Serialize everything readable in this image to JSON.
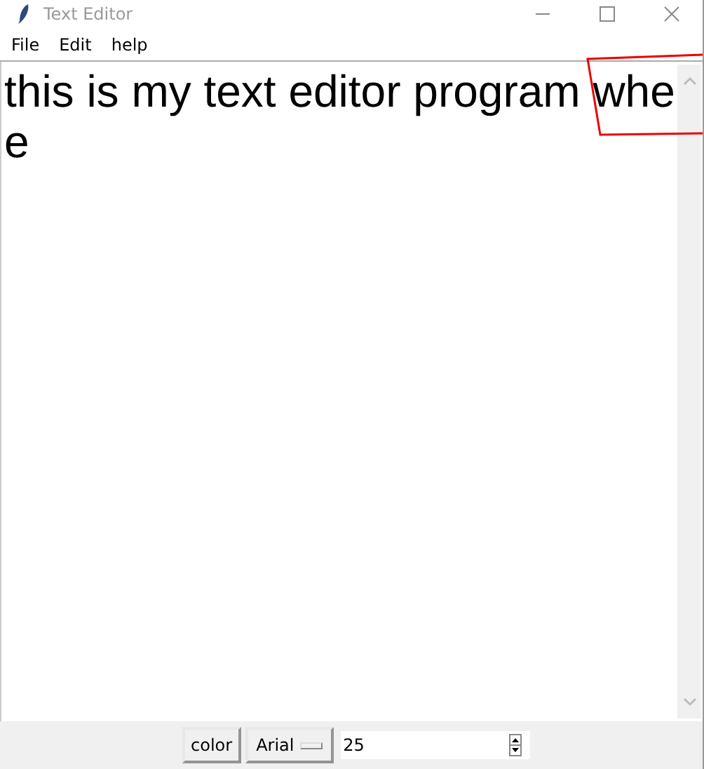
{
  "window": {
    "title": "Text Editor"
  },
  "menu": [
    "File",
    "Edit",
    "help"
  ],
  "editor": {
    "lines": [
      "this is my text editor program whe",
      "e"
    ]
  },
  "toolbar": {
    "color_button": "color",
    "font_menu": "Arial",
    "size_field": "25"
  }
}
